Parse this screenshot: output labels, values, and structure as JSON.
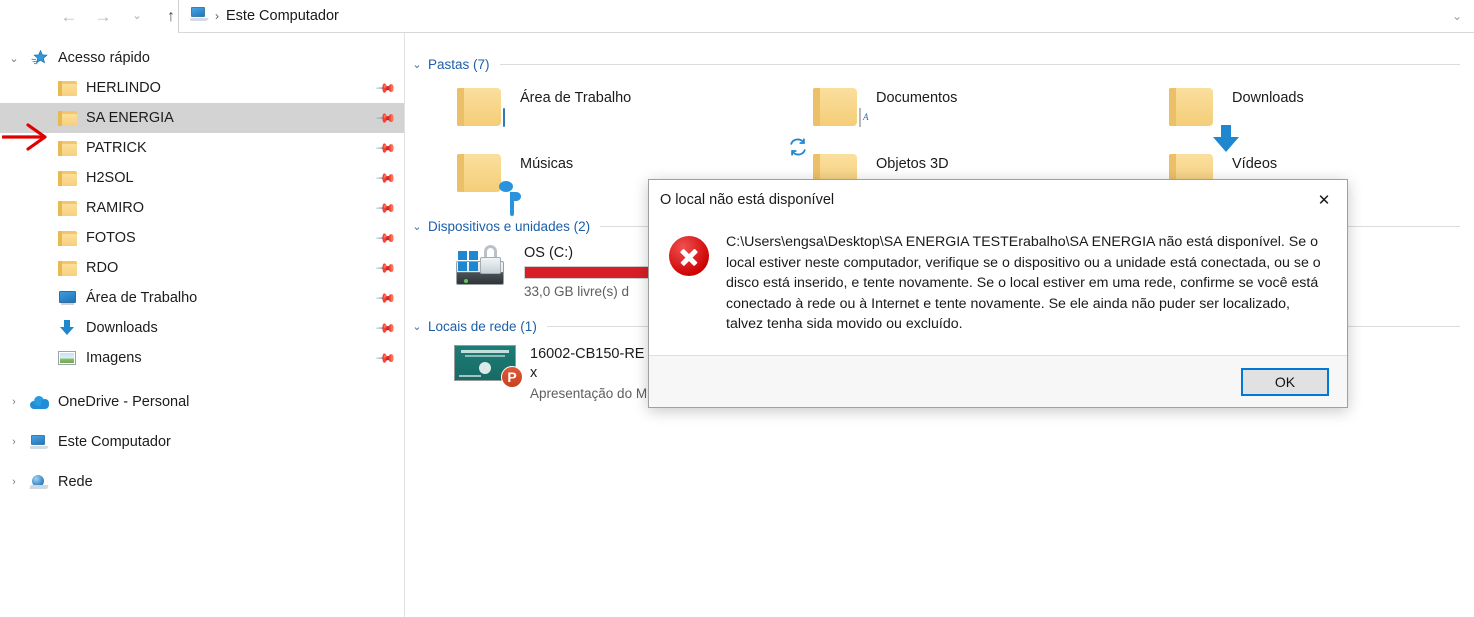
{
  "titlebar": {
    "back_label": "←",
    "forward_label": "→",
    "history_label": "⌄",
    "up_label": "↑",
    "breadcrumb_separator": "›",
    "breadcrumb_text": "Este Computador",
    "address_chevron": "⌄"
  },
  "sidebar": {
    "groups": [
      {
        "label": "Acesso rápido",
        "icon": "star-icon",
        "expander": "⌄",
        "items": [
          {
            "label": "HERLINDO",
            "icon": "folder-icon",
            "pinned": true,
            "selected": false
          },
          {
            "label": "SA ENERGIA",
            "icon": "folder-icon",
            "pinned": true,
            "selected": true
          },
          {
            "label": "PATRICK",
            "icon": "folder-icon",
            "pinned": true,
            "selected": false
          },
          {
            "label": "H2SOL",
            "icon": "folder-icon",
            "pinned": true,
            "selected": false
          },
          {
            "label": "RAMIRO",
            "icon": "folder-icon",
            "pinned": true,
            "selected": false
          },
          {
            "label": "FOTOS",
            "icon": "folder-icon",
            "pinned": true,
            "selected": false
          },
          {
            "label": "RDO",
            "icon": "folder-icon",
            "pinned": true,
            "selected": false
          },
          {
            "label": "Área de Trabalho",
            "icon": "desktop-icon",
            "pinned": true,
            "selected": false
          },
          {
            "label": "Downloads",
            "icon": "download-icon",
            "pinned": true,
            "selected": false
          },
          {
            "label": "Imagens",
            "icon": "pictures-icon",
            "pinned": true,
            "selected": false
          }
        ]
      }
    ],
    "roots": [
      {
        "label": "OneDrive - Personal",
        "icon": "cloud-icon",
        "expander": "›"
      },
      {
        "label": "Este Computador",
        "icon": "pc-icon",
        "expander": "›"
      },
      {
        "label": "Rede",
        "icon": "network-icon",
        "expander": "›"
      }
    ],
    "pin_glyph": "📌"
  },
  "content": {
    "sections": [
      {
        "title": "Pastas (7)",
        "chevron": "⌄"
      },
      {
        "title": "Dispositivos e unidades (2)",
        "chevron": "⌄"
      },
      {
        "title": "Locais de rede (1)",
        "chevron": "⌄"
      }
    ],
    "folders": [
      {
        "label": "Área de Trabalho",
        "icon": "folder-desktop-icon"
      },
      {
        "label": "Documentos",
        "icon": "folder-documents-icon"
      },
      {
        "label": "Downloads",
        "icon": "folder-downloads-icon"
      },
      {
        "label": "Músicas",
        "icon": "folder-music-icon"
      },
      {
        "label": "Objetos 3D",
        "icon": "folder-3dobjects-icon"
      },
      {
        "label": "Vídeos",
        "icon": "folder-videos-icon"
      }
    ],
    "drives": [
      {
        "label": "OS (C:)",
        "icon": "drive-bitlocker-icon",
        "free_text": "33,0 GB livre(s) d",
        "usage_percent": 92,
        "usage_color": "#d81f26"
      }
    ],
    "network_items": [
      {
        "name_line1": "16002-CB150-RE",
        "name_line2": "x",
        "type": "Apresentação do Microsoft Powe...",
        "icon": "powerpoint-icon",
        "badge": "P"
      }
    ],
    "refresh_icon": "refresh-icon"
  },
  "dialog": {
    "title": "O local não está disponível",
    "close_label": "✕",
    "icon": "error-icon",
    "message": "C:\\Users\\engsa\\Desktop\\SA ENERGIA TESTErabalho\\SA ENERGIA não está disponível. Se o local estiver neste computador, verifique se o dispositivo ou a unidade está conectada, ou se o disco está inserido, e tente novamente. Se o local estiver em uma rede, confirme se você está conectado à rede ou à Internet e tente novamente. Se ele ainda não puder ser localizado, talvez tenha sida movido ou excluído.",
    "ok_label": "OK"
  },
  "annotation": {
    "arrow_color": "#e00000",
    "points_to": "SA ENERGIA"
  },
  "colors": {
    "accent": "#0078d7",
    "selection": "#d3d3d3",
    "group_header": "#1c5fa8",
    "error_red": "#cc0000",
    "folder_yellow": "#f6cf7d"
  }
}
